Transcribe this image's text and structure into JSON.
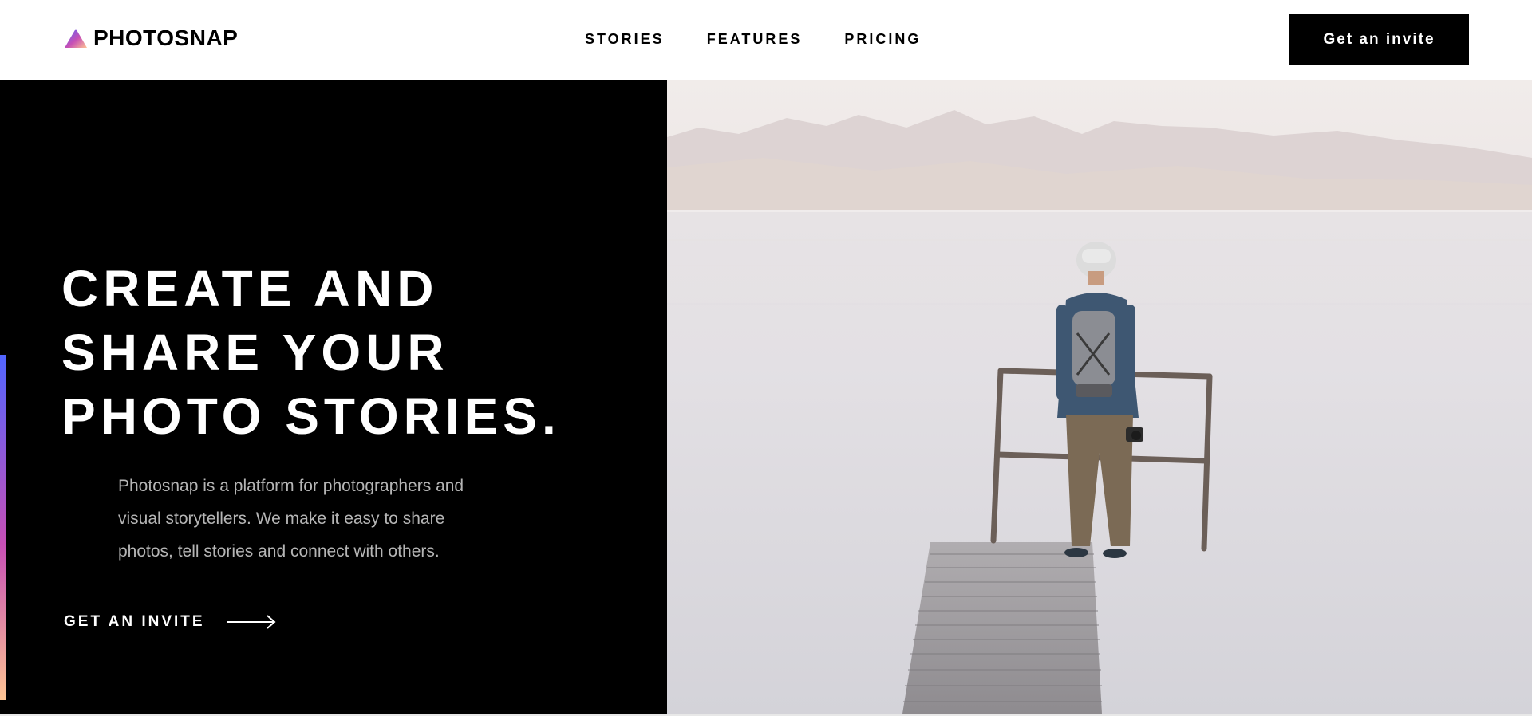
{
  "brand": {
    "name": "PHOTOSNAP"
  },
  "nav": {
    "items": [
      {
        "label": "STORIES"
      },
      {
        "label": "FEATURES"
      },
      {
        "label": "PRICING"
      }
    ]
  },
  "header": {
    "cta_label": "Get an invite"
  },
  "hero": {
    "title_lines": [
      "CREATE AND",
      "SHARE YOUR",
      "PHOTO STORIES."
    ],
    "description_lines": [
      "Photosnap is a platform for photographers and",
      "visual storytellers. We make it easy to share",
      "photos, tell stories and connect with others."
    ],
    "link_label": "GET AN INVITE",
    "image_icon": "person-on-pier-photo"
  },
  "colors": {
    "accent_gradient": [
      "#5165ff",
      "#c74fb5",
      "#ffc593"
    ],
    "hero_bg": "#000000",
    "text_white": "#ffffff",
    "text_muted": "#b5b5b5"
  },
  "icons": {
    "logo": "triangle-logo-icon",
    "arrow": "arrow-right-icon"
  }
}
